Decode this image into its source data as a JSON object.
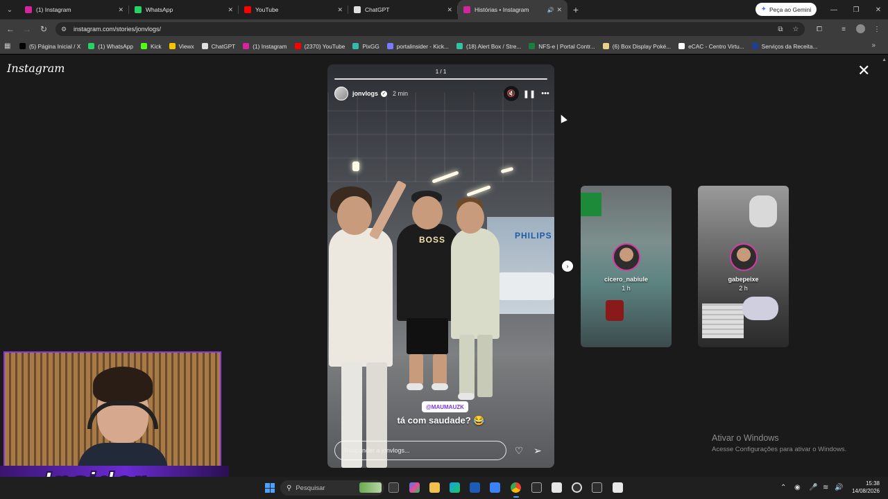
{
  "browser": {
    "tabs": [
      {
        "title": "(1) Instagram",
        "color": "#d6249f",
        "active": false
      },
      {
        "title": "WhatsApp",
        "color": "#25d366",
        "active": false
      },
      {
        "title": "YouTube",
        "color": "#ff0000",
        "active": false
      },
      {
        "title": "ChatGPT",
        "color": "#e0e0e0",
        "active": false
      },
      {
        "title": "Histórias • Instagram",
        "color": "#d6249f",
        "active": true
      }
    ],
    "gemini_label": "Peça ao Gemini",
    "url": "instagram.com/stories/jonvlogs/",
    "bookmarks": [
      {
        "label": "(5) Página Inicial / X",
        "color": "#000000"
      },
      {
        "label": "(1) WhatsApp",
        "color": "#25d366"
      },
      {
        "label": "Kick",
        "color": "#53fc18"
      },
      {
        "label": "Viewx",
        "color": "#f5c400"
      },
      {
        "label": "ChatGPT",
        "color": "#e0e0e0"
      },
      {
        "label": "(1) Instagram",
        "color": "#d6249f"
      },
      {
        "label": "(2370) YouTube",
        "color": "#ff0000"
      },
      {
        "label": "PixGG",
        "color": "#32bcad"
      },
      {
        "label": "portalinsider - Kick...",
        "color": "#7a7aff"
      },
      {
        "label": "(18) Alert Box / Stre...",
        "color": "#31c3a2"
      },
      {
        "label": "NFS-e | Portal Contr...",
        "color": "#1a7f3c"
      },
      {
        "label": "(6) Box Display Poké...",
        "color": "#e8d08a"
      },
      {
        "label": "eCAC - Centro Virtu...",
        "color": "#ffffff"
      },
      {
        "label": "Serviços da Receita...",
        "color": "#1c3f94"
      }
    ]
  },
  "instagram": {
    "logo": "Instagram",
    "story": {
      "counter": "1 / 1",
      "username": "jonvlogs",
      "time_ago": "2 min",
      "overlay_brand": "PHILIPS",
      "shirt_text": "BOSS",
      "mention": "@MAUMAUZK",
      "caption": "tá com saudade? 😂",
      "reply_placeholder": "Responder a jonvlogs..."
    },
    "previews": [
      {
        "username": "cicero_nabiule",
        "time_ago": "1 h"
      },
      {
        "username": "gabepeixe",
        "time_ago": "2 h"
      }
    ]
  },
  "watermark": {
    "line1": "Ativar o Windows",
    "line2": "Acesse Configurações para ativar o Windows."
  },
  "overlay": {
    "banner_text": "Insider"
  },
  "taskbar": {
    "search_placeholder": "Pesquisar",
    "time": "15:38",
    "date": "14/08/2026"
  }
}
